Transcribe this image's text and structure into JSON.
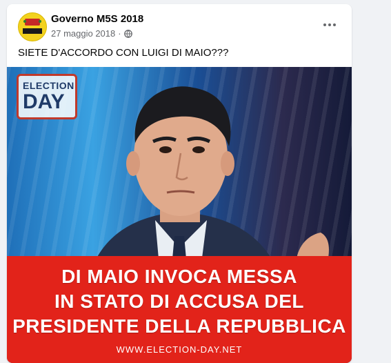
{
  "post": {
    "page_name": "Governo M5S 2018",
    "date": "27 maggio 2018",
    "separator": "·",
    "text": "SIETE D'ACCORDO CON LUIGI DI MAIO???"
  },
  "media": {
    "badge_top": "ELECTION",
    "badge_bottom": "DAY",
    "headline_line1": "DI MAIO INVOCA MESSA",
    "headline_line2": "IN STATO DI ACCUSA DEL",
    "headline_line3": "PRESIDENTE DELLA REPUBBLICA",
    "website": "WWW.ELECTION-DAY.NET",
    "banner_color": "#e2231a"
  },
  "icons": {
    "audience": "globe-icon",
    "menu": "more-options-icon"
  }
}
